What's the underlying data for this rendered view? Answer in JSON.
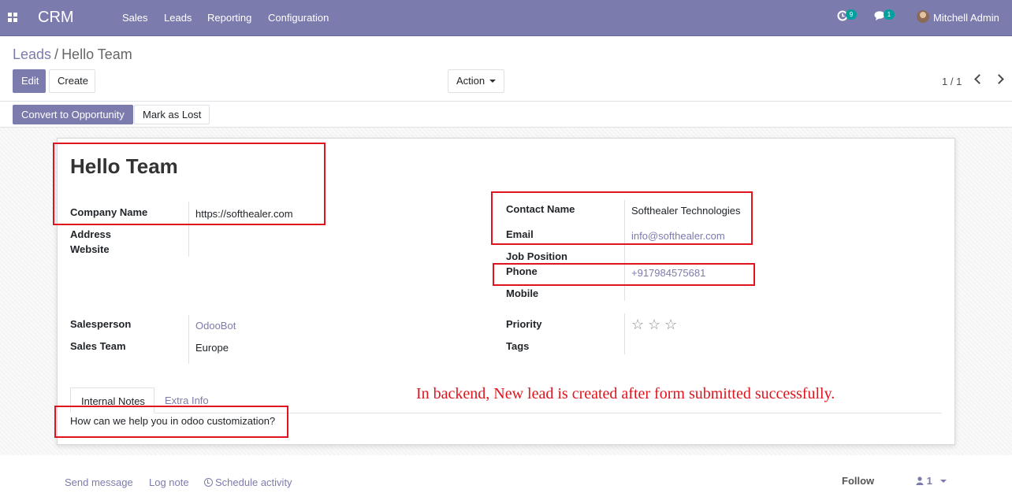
{
  "navbar": {
    "brand": "CRM",
    "menu": [
      "Sales",
      "Leads",
      "Reporting",
      "Configuration"
    ],
    "activity_count": "9",
    "message_count": "1",
    "user_name": "Mitchell Admin",
    "background_color": "#7c7bad"
  },
  "breadcrumb": {
    "parent": "Leads",
    "separator": "/",
    "current": "Hello Team"
  },
  "control_panel": {
    "edit_label": "Edit",
    "create_label": "Create",
    "action_label": "Action",
    "pager": "1 / 1"
  },
  "statusbar": {
    "convert_label": "Convert to Opportunity",
    "lost_label": "Mark as Lost"
  },
  "form": {
    "title": "Hello Team",
    "company_name_label": "Company Name",
    "company_name": "https://softhealer.com",
    "address_label": "Address",
    "website_label": "Website",
    "contact_name_label": "Contact Name",
    "contact_name": "Softhealer Technologies",
    "email_label": "Email",
    "email": "info@softhealer.com",
    "job_position_label": "Job Position",
    "phone_label": "Phone",
    "phone": "+917984575681",
    "mobile_label": "Mobile",
    "salesperson_label": "Salesperson",
    "salesperson": "OdooBot",
    "sales_team_label": "Sales Team",
    "sales_team": "Europe",
    "priority_label": "Priority",
    "priority_stars": "☆",
    "priority_value": 0,
    "tags_label": "Tags"
  },
  "tabs": {
    "internal_notes": "Internal Notes",
    "extra_info": "Extra Info",
    "notes_text": "How can we help you in odoo customization?"
  },
  "annotation": {
    "text": "In backend, New lead is created after form submitted successfully.",
    "color": "#e0141c"
  },
  "chatter": {
    "send_message": "Send message",
    "log_note": "Log note",
    "schedule_activity": "Schedule activity",
    "follow": "Follow",
    "followers_count": "1"
  }
}
